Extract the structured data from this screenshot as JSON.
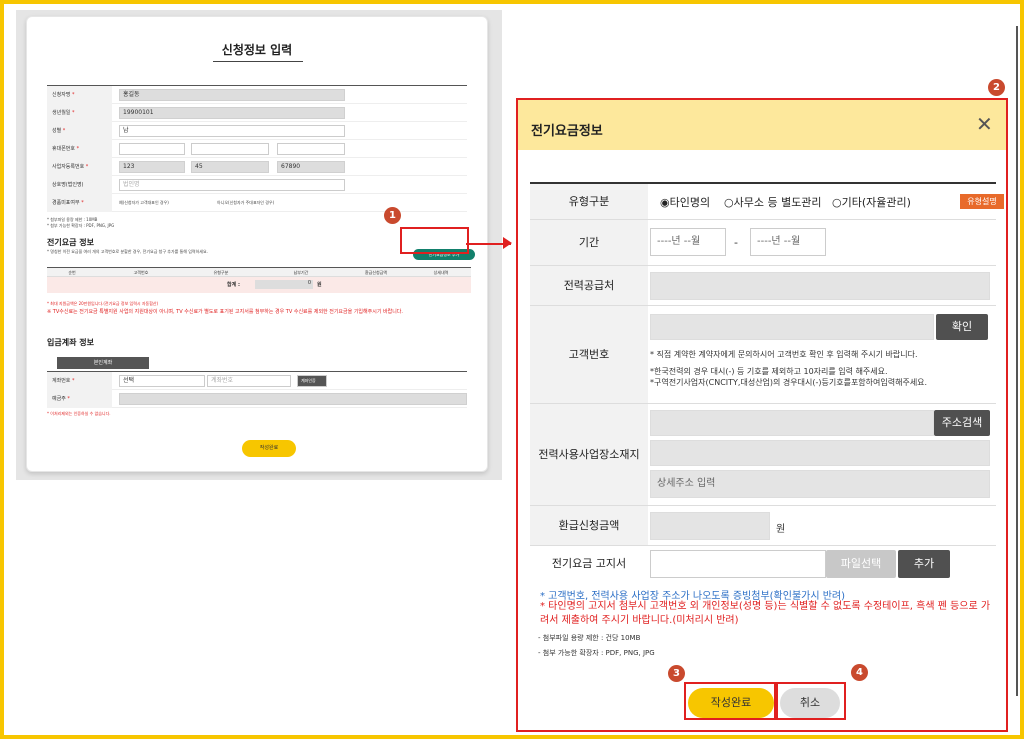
{
  "left": {
    "title": "신청정보 입력",
    "fields": [
      {
        "label": "신청자명",
        "value": ""
      },
      {
        "label": "생년월일",
        "value": "19900101"
      },
      {
        "label": "성별",
        "value": "남"
      },
      {
        "label": "휴대폰번호",
        "value": ""
      },
      {
        "label": "사업자등록번호",
        "value1": "123",
        "value2": "45",
        "value3": "67890"
      },
      {
        "label": "상호명(법인명)",
        "placeholder": "법인명"
      },
      {
        "label": "경품미표여부",
        "opt1": "예(신청자가 고객대표인 경우)",
        "opt2": "아니오(신청자가 주대표자인 경우)"
      }
    ],
    "name_value": "홍길동",
    "req": "*",
    "limits": [
      "* 첨부파일 용량 제한 : 10MB",
      "* 첨부 가능한 확장자 : PDF, PNG, JPG"
    ],
    "section1": "전기요금 정보",
    "section1_sub": "* 명칭한 이전 요금을 여러 개의 고객번호로 분할한 경우, 전기요금 청구 추가를 통해 입력하세요.",
    "add_btn": "전기요금정보 추가",
    "table_headers": [
      "순번",
      "고객번호",
      "유형구분",
      "납부기간",
      "환급신청금액",
      "상세내역"
    ],
    "sum_label": "합계 :",
    "sum_value": "0",
    "sum_unit": "원",
    "note1": "* 최대 지원금액은 20만원입니다.(전기요금 정보 입력시 자동합산)",
    "note2": "※ TV수신료는 전기요금 특별지원 사업의 지원대상이 아니며, TV 수신료가 별도로 표기된 고지서를 첨부하는 경우 TV 수신료를 제외한 전기요금을 기입해주시기 바랍니다.",
    "section2": "입금계좌 정보",
    "self_btn": "본인계좌",
    "bank_label": "계좌번호",
    "bank_select": "선택",
    "acct_placeholder": "계좌번호",
    "verify_btn": "계좌인증",
    "holder_label": "예금주",
    "holder_note": "* 이처리제외는 인증하실 수 없습니다.",
    "submit": "작성완료"
  },
  "modal": {
    "title": "전기요금정보",
    "close": "✕",
    "type_label": "유형구분",
    "types": [
      "◉타인명의",
      "○사무소 등 별도관리",
      "○기타(자율관리)"
    ],
    "type_tag": "유형설명",
    "period_label": "기간",
    "period_ph": "----년 --월",
    "period_sep": "-",
    "supplier_label": "전력공급처",
    "customer_label": "고객번호",
    "confirm_btn": "확인",
    "cust_note1": "* 직접 계약한 계약자에게 문의하시어 고객번호 확인 후 입력해 주시기 바랍니다.",
    "cust_note2": "*한국전력의 경우 대시(-) 등 기호를 제외하고 10자리를 입력 해주세요.",
    "cust_note3": "*구역전기사업자(CNCITY,대성산업)의 경우대시(-)등기호를포함하여입력해주세요.",
    "addr_label1": "전력사용",
    "addr_label2": "사업장소재지",
    "addr_btn": "주소검색",
    "addr_detail": "상세주소 입력",
    "refund_label": "환급신청금액",
    "refund_unit": "원",
    "bill_label": "전기요금 고지서",
    "file_btn": "파일선택",
    "add_btn": "추가",
    "note_blue": "* 고객번호, 전력사용 사업장 주소가 나오도록 증빙첨부(확인불가시 반려)",
    "note_red": "* 타인명의 고지서 첨부시 고객번호 외 개인정보(성명 등)는 식별할 수 없도록 수정테이프, 흑색 펜 등으로 가려서 제출하여 주시기 바랍니다.(미처리시 반려)",
    "limit1": "- 첨부파일 용량 제한 : 건당 10MB",
    "limit2": "- 첨부 가능한 확장자 : PDF, PNG, JPG",
    "submit": "작성완료",
    "cancel": "취소"
  },
  "badges": [
    "1",
    "2",
    "3",
    "4"
  ],
  "colors": {
    "accent": "#f7c600",
    "highlight": "#e02020",
    "badge": "#c94a2e",
    "green": "#12806c"
  }
}
